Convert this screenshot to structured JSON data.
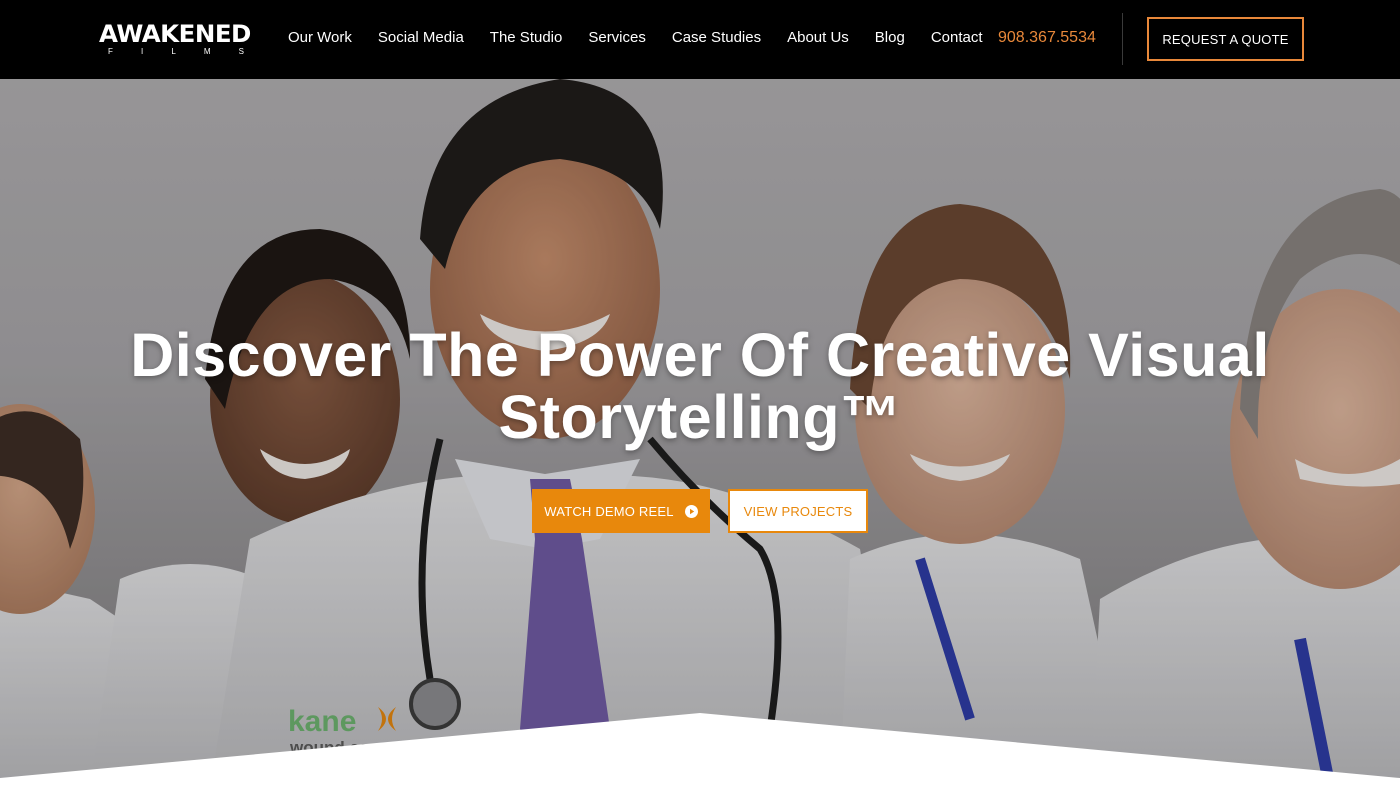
{
  "header": {
    "logo": {
      "main": "AWAKENED",
      "sub": [
        "F",
        "I",
        "L",
        "M",
        "S"
      ]
    },
    "nav": [
      {
        "label": "Our Work"
      },
      {
        "label": "Social Media"
      },
      {
        "label": "The Studio"
      },
      {
        "label": "Services"
      },
      {
        "label": "Case Studies"
      },
      {
        "label": "About Us"
      },
      {
        "label": "Blog"
      },
      {
        "label": "Contact"
      }
    ],
    "phone": "908.367.5534",
    "quote_button": "REQUEST A QUOTE"
  },
  "hero": {
    "title_line1": "Discover The Power Of Creative Visual",
    "title_line2": "Storytelling™",
    "demo_button": "WATCH DEMO REEL",
    "demo_icon": "play-circle-icon",
    "projects_button": "VIEW PROJECTS",
    "coat_logo": {
      "word": "kane",
      "tagline": "wound care"
    }
  },
  "colors": {
    "header_bg": "#000000",
    "accent_orange": "#e8880c",
    "phone_orange": "#e8883a",
    "white": "#ffffff"
  }
}
